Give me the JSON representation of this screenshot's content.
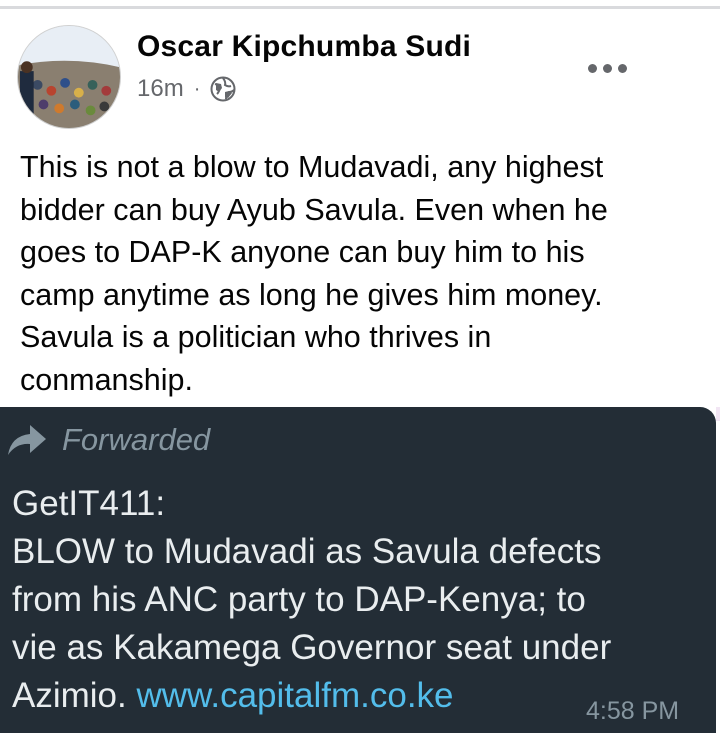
{
  "post": {
    "author_name": "Oscar Kipchumba Sudi",
    "time_ago": "16m",
    "separator": "·",
    "privacy_icon": "globe-icon",
    "more_icon": "more-options-icon",
    "text_lines": [
      "This is not a blow to Mudavadi, any highest",
      "bidder can buy Ayub Savula. Even when he",
      "goes to DAP-K anyone can buy him to his",
      "camp anytime as long he gives him money.",
      "Savula is a politician who thrives in",
      "conmanship."
    ]
  },
  "forwarded_message": {
    "forward_label": "Forwarded",
    "forward_icon": "forward-arrow-icon",
    "lines": [
      "GetIT411:",
      "BLOW to Mudavadi as Savula defects",
      "from his ANC party to DAP-Kenya; to",
      "vie as Kakamega Governor seat under"
    ],
    "last_line_prefix": "Azimio. ",
    "link": "www.capitalfm.co.ke",
    "time": "4:58 PM"
  },
  "colors": {
    "chat_background": "#232d36",
    "link": "#53bdeb",
    "meta_text": "#65676b",
    "message_text": "#e9edef",
    "muted_text": "#8696a0"
  }
}
